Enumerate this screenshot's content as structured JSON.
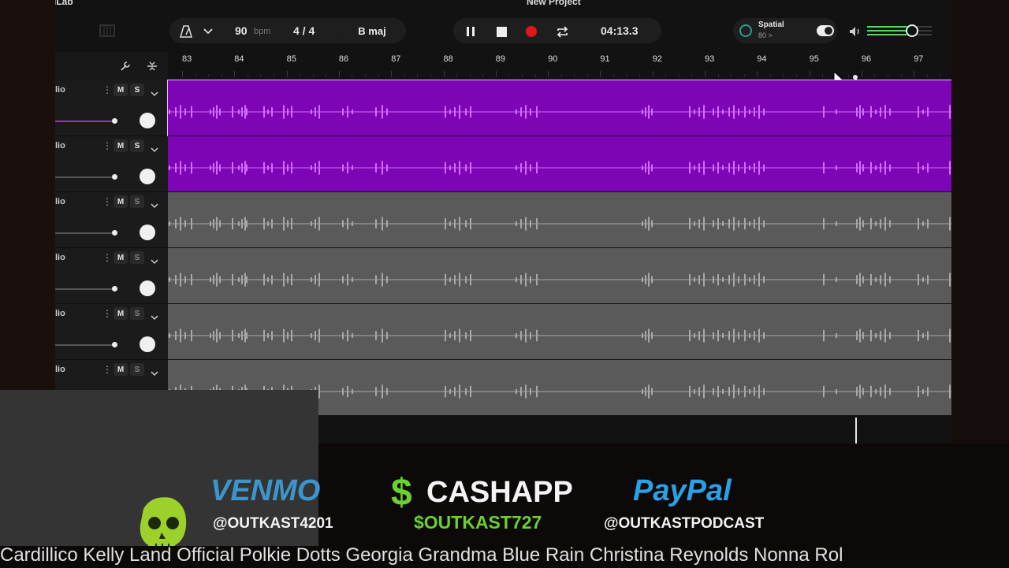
{
  "app": {
    "name": "dLab",
    "project_title": "New Project"
  },
  "toolbar": {
    "tempo": "90",
    "tempo_unit": "bpm",
    "time_signature": "4 / 4",
    "key": "B maj",
    "time": "04:13.3",
    "spatial_label": "Spatial",
    "spatial_value": "80 >"
  },
  "ruler": {
    "bars": [
      "83",
      "84",
      "85",
      "86",
      "87",
      "88",
      "89",
      "90",
      "91",
      "92",
      "93",
      "94",
      "95",
      "96",
      "97"
    ]
  },
  "tracks": [
    {
      "name": "lio",
      "mute": "M",
      "solo": "S",
      "color": "#7d05b5",
      "fader_level": 0.9
    },
    {
      "name": "lio",
      "mute": "M",
      "solo": "S",
      "color": "#7d05b5",
      "fader_level": 0.9
    },
    {
      "name": "lio",
      "mute": "M",
      "solo": "S",
      "color": "#5a5a5a",
      "fader_level": 0.9
    },
    {
      "name": "lio",
      "mute": "M",
      "solo": "S",
      "color": "#5a5a5a",
      "fader_level": 0.9
    },
    {
      "name": "lio",
      "mute": "M",
      "solo": "S",
      "color": "#5a5a5a",
      "fader_level": 0.9
    },
    {
      "name": "lio",
      "mute": "M",
      "solo": "S",
      "color": "#5a5a5a",
      "fader_level": 0.9
    }
  ],
  "donations": {
    "venmo_title": "VENMO",
    "venmo_handle": "@OUTKAST4201",
    "cashapp_symbol": "$",
    "cashapp_title": "CASHAPP",
    "cashapp_handle": "$OUTKAST727",
    "paypal_title": "PayPal",
    "paypal_handle": "@OUTKASTPODCAST"
  },
  "ticker": {
    "text": "Cardillico  Kelly Land  Official Polkie Dotts Georgia Grandma Blue Rain  Christina Reynolds Nonna Rol"
  },
  "colors": {
    "purple_clip": "#7d05b5",
    "grey_clip": "#5a5a5a",
    "record": "#e0161b",
    "meter": "#5fd35f",
    "venmo": "#3d95ce",
    "cashapp": "#6bd12f",
    "paypal": "#2aa0e8"
  }
}
